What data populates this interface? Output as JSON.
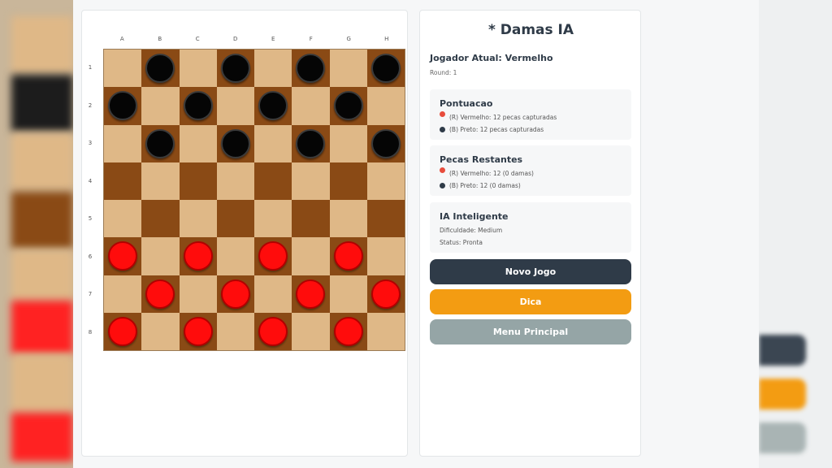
{
  "title": "* Damas IA",
  "current_player": "Jogador Atual: Vermelho",
  "round": "Round: 1",
  "columns": [
    "A",
    "B",
    "C",
    "D",
    "E",
    "F",
    "G",
    "H"
  ],
  "rows": [
    "1",
    "2",
    "3",
    "4",
    "5",
    "6",
    "7",
    "8"
  ],
  "board": [
    [
      null,
      "black",
      null,
      "black",
      null,
      "black",
      null,
      "black"
    ],
    [
      "black",
      null,
      "black",
      null,
      "black",
      null,
      "black",
      null
    ],
    [
      null,
      "black",
      null,
      "black",
      null,
      "black",
      null,
      "black"
    ],
    [
      null,
      null,
      null,
      null,
      null,
      null,
      null,
      null
    ],
    [
      null,
      null,
      null,
      null,
      null,
      null,
      null,
      null
    ],
    [
      "red",
      null,
      "red",
      null,
      "red",
      null,
      "red",
      null
    ],
    [
      null,
      "red",
      null,
      "red",
      null,
      "red",
      null,
      "red"
    ],
    [
      "red",
      null,
      "red",
      null,
      "red",
      null,
      "red",
      null
    ]
  ],
  "score": {
    "title": "Pontuacao",
    "red": "(R) Vermelho: 12 pecas capturadas",
    "black": "(B) Preto: 12 pecas capturadas"
  },
  "remaining": {
    "title": "Pecas Restantes",
    "red": "(R) Vermelho: 12 (0 damas)",
    "black": "(B) Preto: 12 (0 damas)"
  },
  "ai": {
    "title": "IA Inteligente",
    "difficulty": "Dificuldade: Medium",
    "status": "Status: Pronta"
  },
  "buttons": {
    "new_game": "Novo Jogo",
    "hint": "Dica",
    "main_menu": "Menu Principal"
  },
  "colors": {
    "light_square": "#dfb887",
    "dark_square": "#8a4a15",
    "red_piece": "#ff0c0c",
    "black_piece": "#050505",
    "new_game_button": "#2f3b48",
    "hint_button": "#f39c12",
    "menu_button": "#95a5a6"
  }
}
